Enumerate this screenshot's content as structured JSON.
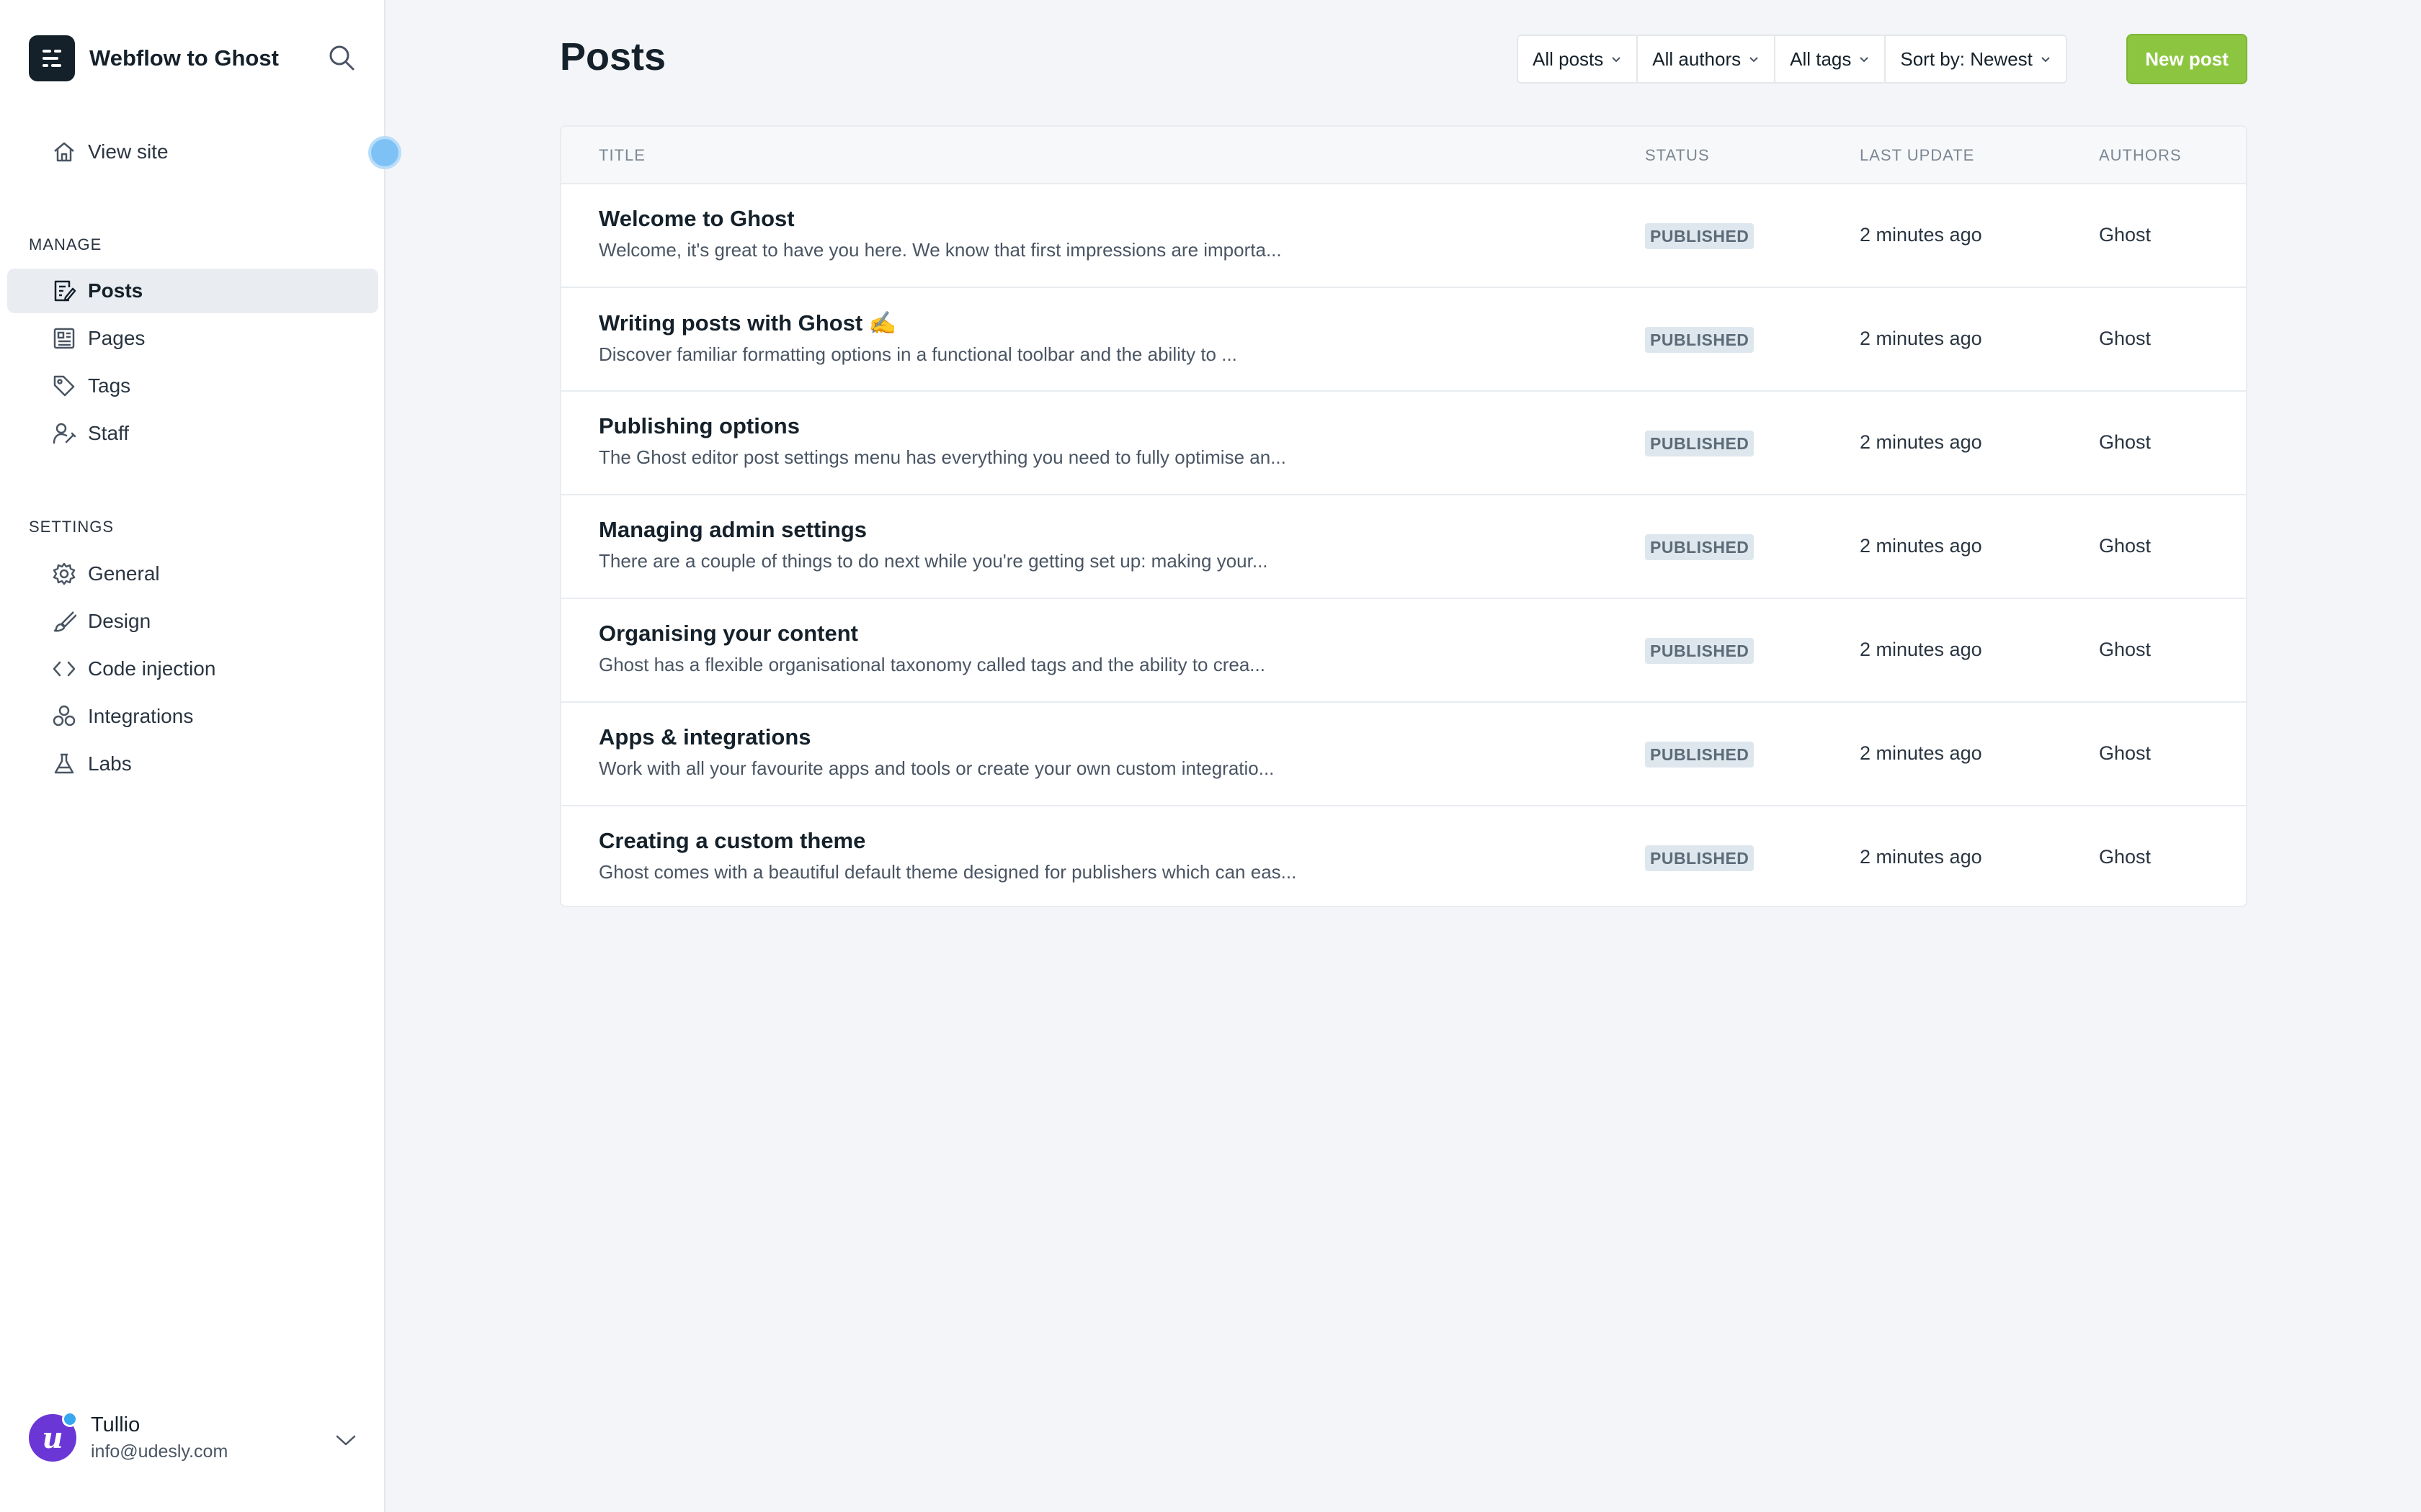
{
  "brand": {
    "title": "Webflow to Ghost"
  },
  "sidebar": {
    "view_site": "View site",
    "manage_label": "MANAGE",
    "manage_items": [
      {
        "label": "Posts",
        "icon": "posts-icon",
        "active": true
      },
      {
        "label": "Pages",
        "icon": "pages-icon"
      },
      {
        "label": "Tags",
        "icon": "tag-icon"
      },
      {
        "label": "Staff",
        "icon": "staff-icon"
      }
    ],
    "settings_label": "SETTINGS",
    "settings_items": [
      {
        "label": "General",
        "icon": "gear-icon"
      },
      {
        "label": "Design",
        "icon": "brush-icon"
      },
      {
        "label": "Code injection",
        "icon": "code-icon"
      },
      {
        "label": "Integrations",
        "icon": "integrations-icon"
      },
      {
        "label": "Labs",
        "icon": "flask-icon"
      }
    ]
  },
  "user": {
    "name": "Tullio",
    "email": "info@udesly.com",
    "avatar_letter": "u"
  },
  "main": {
    "title": "Posts",
    "filters": [
      "All posts",
      "All authors",
      "All tags",
      "Sort by: Newest"
    ],
    "new_post_label": "New post"
  },
  "table": {
    "headers": {
      "title": "TITLE",
      "status": "STATUS",
      "last_update": "LAST UPDATE",
      "authors": "AUTHORS"
    },
    "rows": [
      {
        "title": "Welcome to Ghost",
        "excerpt": "Welcome, it's great to have you here. We know that first impressions are importa...",
        "status": "PUBLISHED",
        "updated": "2 minutes ago",
        "author": "Ghost"
      },
      {
        "title": "Writing posts with Ghost ✍️",
        "excerpt": "Discover familiar formatting options in a functional toolbar and the ability to ...",
        "status": "PUBLISHED",
        "updated": "2 minutes ago",
        "author": "Ghost"
      },
      {
        "title": "Publishing options",
        "excerpt": "The Ghost editor post settings menu has everything you need to fully optimise an...",
        "status": "PUBLISHED",
        "updated": "2 minutes ago",
        "author": "Ghost"
      },
      {
        "title": "Managing admin settings",
        "excerpt": "There are a couple of things to do next while you're getting set up: making your...",
        "status": "PUBLISHED",
        "updated": "2 minutes ago",
        "author": "Ghost"
      },
      {
        "title": "Organising your content",
        "excerpt": "Ghost has a flexible organisational taxonomy called tags and the ability to crea...",
        "status": "PUBLISHED",
        "updated": "2 minutes ago",
        "author": "Ghost"
      },
      {
        "title": "Apps & integrations",
        "excerpt": "Work with all your favourite apps and tools or create your own custom integratio...",
        "status": "PUBLISHED",
        "updated": "2 minutes ago",
        "author": "Ghost"
      },
      {
        "title": "Creating a custom theme",
        "excerpt": "Ghost comes with a beautiful default theme designed for publishers which can eas...",
        "status": "PUBLISHED",
        "updated": "2 minutes ago",
        "author": "Ghost"
      }
    ]
  },
  "colors": {
    "accent": "#8cc640",
    "sidebar_active": "#e9edf2",
    "badge_bg": "#dfe7ee"
  }
}
